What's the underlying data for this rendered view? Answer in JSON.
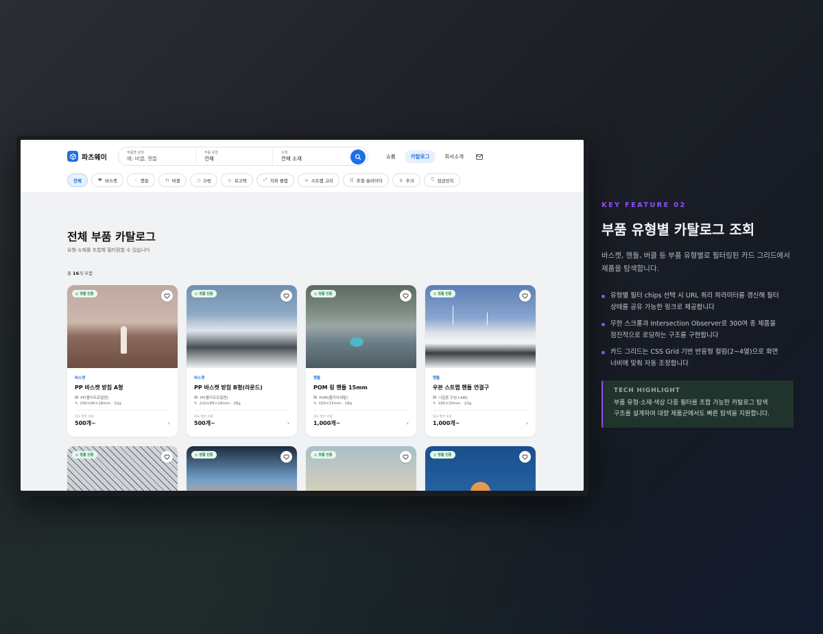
{
  "header": {
    "logo_text": "파츠웨이",
    "search": {
      "name_label": "부품명 검색",
      "name_placeholder": "예: 버클, 핸들",
      "type_label": "부품 유형",
      "type_value": "전체",
      "material_label": "소재",
      "material_value": "전체 소재"
    },
    "nav": [
      "쇼룸",
      "카탈로그",
      "회사소개"
    ],
    "chips": [
      {
        "label": "전체",
        "icon": ""
      },
      {
        "label": "바스켓",
        "icon": "basket-icon"
      },
      {
        "label": "핸들",
        "icon": "grid-dots-icon"
      },
      {
        "label": "버클",
        "icon": "lock-icon"
      },
      {
        "label": "D링",
        "icon": "ring-icon"
      },
      {
        "label": "로고택",
        "icon": "tag-icon"
      },
      {
        "label": "지퍼 풀랩",
        "icon": "resize-icon"
      },
      {
        "label": "스트랩 고리",
        "icon": "link-icon"
      },
      {
        "label": "조절 슬라이더",
        "icon": "sliders-icon"
      },
      {
        "label": "후크",
        "icon": "anchor-icon"
      },
      {
        "label": "잠금장치",
        "icon": "shield-icon"
      }
    ]
  },
  "main": {
    "title": "전체 부품 카탈로그",
    "subtitle": "유형·소재를 조합해 필터링할 수 있습니다",
    "count_prefix": "총 ",
    "count_value": "16",
    "count_suffix": "개 부품",
    "badge_text": "정품 인증",
    "moq_label": "최소 발주 수량",
    "products": [
      {
        "category": "바스켓",
        "name": "PP 바스켓 받침 A형",
        "material": "PP(폴리프로필렌)",
        "size": "240×90×18mm · 32g",
        "moq": "500개~"
      },
      {
        "category": "바스켓",
        "name": "PP 바스켓 받침 B형(라운드)",
        "material": "PP(폴리프로필렌)",
        "size": "220×85×16mm · 28g",
        "moq": "500개~"
      },
      {
        "category": "핸들",
        "name": "POM 링 핸들 15mm",
        "material": "POM(폴리아세탈)",
        "size": "150×15mm · 18g",
        "moq": "1,000개~"
      },
      {
        "category": "핸들",
        "name": "우븐 스트랩 핸들 연결구",
        "material": "나일론 우븐+ABS",
        "size": "180×20mm · 22g",
        "moq": "1,000개~"
      }
    ]
  },
  "feature": {
    "kicker": "KEY FEATURE 02",
    "heading": "부품 유형별 카탈로그 조회",
    "desc_1": "바스켓, 핸들, 버클 등 부품 유형별로 필터링된 카드 그리드에서",
    "desc_2": "제품을 탐색합니다.",
    "bullets": [
      {
        "l1": "유형별 필터 chips 선택 시 URL 쿼리 파라미터를 갱신해 필터",
        "l2": "상태를 공유 가능한 링크로 제공합니다"
      },
      {
        "l1": "무한 스크롤과 Intersection Observer로 300여 종 제품을",
        "l2": "점진적으로 로딩하는 구조를 구현합니다"
      },
      {
        "l1": "카드 그리드는 CSS Grid 기반 반응형 컬럼(2~4열)으로 화면",
        "l2": "너비에 맞춰 자동 조정합니다"
      }
    ],
    "tech_title": "TECH HIGHLIGHT",
    "tech_l1": "부품 유형·소재·색상 다중 필터를 조합 가능한 카탈로그 탐색",
    "tech_l2": "구조를 설계하여 대량 제품군에서도 빠른 탐색을 지원합니다."
  },
  "colors": {
    "accent": "#1f6fe5",
    "feature_accent": "#8e4ff7",
    "verified": "#1f8a4c"
  }
}
